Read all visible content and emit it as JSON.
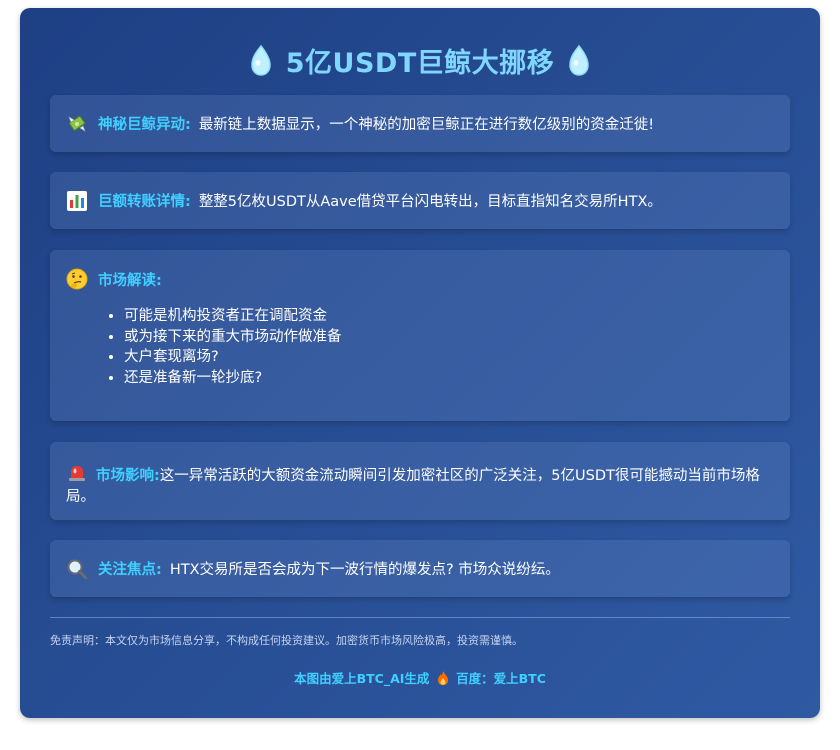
{
  "title": "5亿USDT巨鲸大挪移",
  "icons": {
    "title_left": "whale-icon",
    "title_right": "whale-icon",
    "s1": "money-wings-icon",
    "s2": "bar-chart-icon",
    "s3": "thinking-face-icon",
    "s4": "siren-icon",
    "s5": "magnifier-icon",
    "footer": "fire-icon"
  },
  "sections": {
    "s1": {
      "label": "神秘巨鲸异动:",
      "text": "最新链上数据显示，一个神秘的加密巨鲸正在进行数亿级别的资金迁徙!"
    },
    "s2": {
      "label": "巨额转账详情:",
      "text": "整整5亿枚USDT从Aave借贷平台闪电转出，目标直指知名交易所HTX。"
    },
    "s3": {
      "label": "市场解读:",
      "items": [
        "可能是机构投资者正在调配资金",
        "或为接下来的重大市场动作做准备",
        "大户套现离场?",
        "还是准备新一轮抄底?"
      ]
    },
    "s4": {
      "label": "市场影响:",
      "text": "这一异常活跃的大额资金流动瞬间引发加密社区的广泛关注，5亿USDT很可能撼动当前市场格局。"
    },
    "s5": {
      "label": "关注焦点:",
      "text": "HTX交易所是否会成为下一波行情的爆发点? 市场众说纷纭。"
    }
  },
  "disclaimer": "免责声明：本文仅为市场信息分享，不构成任何投资建议。加密货币市场风险极高，投资需谨慎。",
  "footer": {
    "left": "本图由爱上BTC_AI生成",
    "right": "百度：爱上BTC"
  },
  "colors": {
    "accent": "#3fd0ff",
    "title": "#7fd6ff",
    "card_bg": "#264c92"
  }
}
